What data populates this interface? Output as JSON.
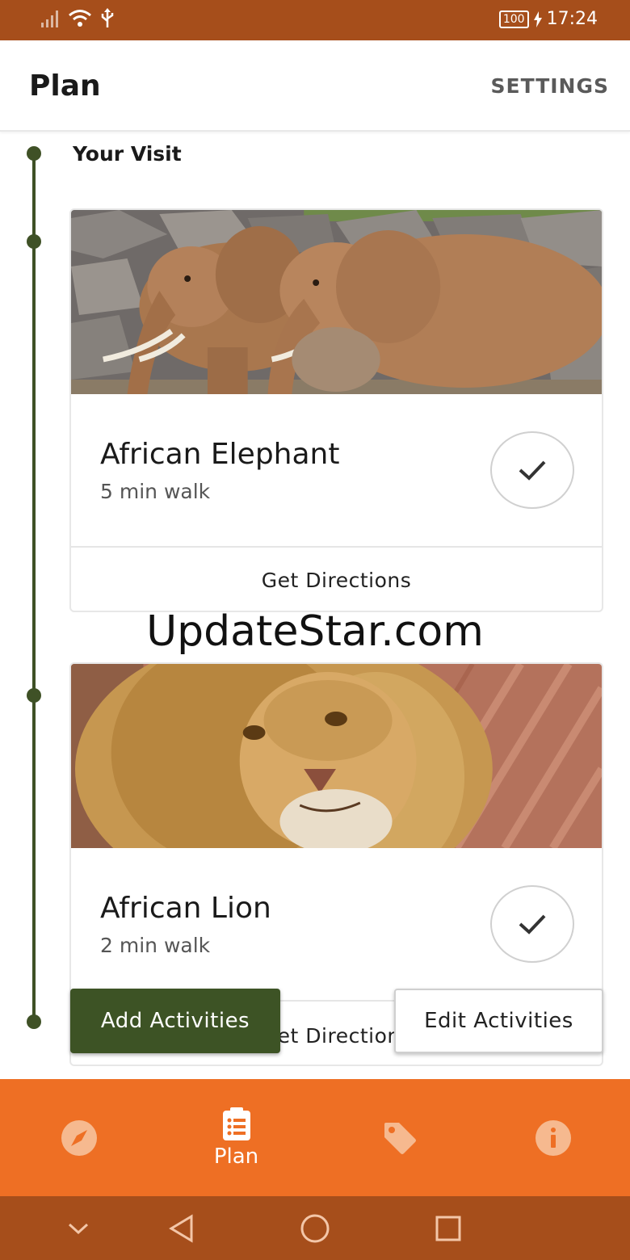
{
  "status_bar": {
    "battery": "100",
    "time": "17:24",
    "icons": [
      "signal-icon",
      "wifi-icon",
      "usb-icon",
      "charging-icon"
    ]
  },
  "app_bar": {
    "title": "Plan",
    "settings_label": "SETTINGS"
  },
  "visit": {
    "section_title": "Your Visit",
    "items": [
      {
        "name": "African Elephant",
        "walk": "5 min walk",
        "directions_label": "Get Directions",
        "photo": "elephants-photo"
      },
      {
        "name": "African Lion",
        "walk": "2 min walk",
        "directions_label": "Get Directions",
        "photo": "lion-photo"
      }
    ]
  },
  "watermark": "UpdateStar.com",
  "actions": {
    "add_label": "Add Activities",
    "edit_label": "Edit Activities"
  },
  "bottom_nav": {
    "items": [
      {
        "icon": "compass-icon",
        "label": ""
      },
      {
        "icon": "checklist-icon",
        "label": "Plan"
      },
      {
        "icon": "tag-icon",
        "label": ""
      },
      {
        "icon": "info-icon",
        "label": ""
      }
    ],
    "active_index": 1
  },
  "system_nav": [
    "chevron-down-icon",
    "back-icon",
    "home-icon",
    "recents-icon"
  ],
  "colors": {
    "status_bar": "#a64e1b",
    "bottom_nav": "#ee6f24",
    "accent_green": "#3d5325",
    "timeline": "#3f5126"
  }
}
